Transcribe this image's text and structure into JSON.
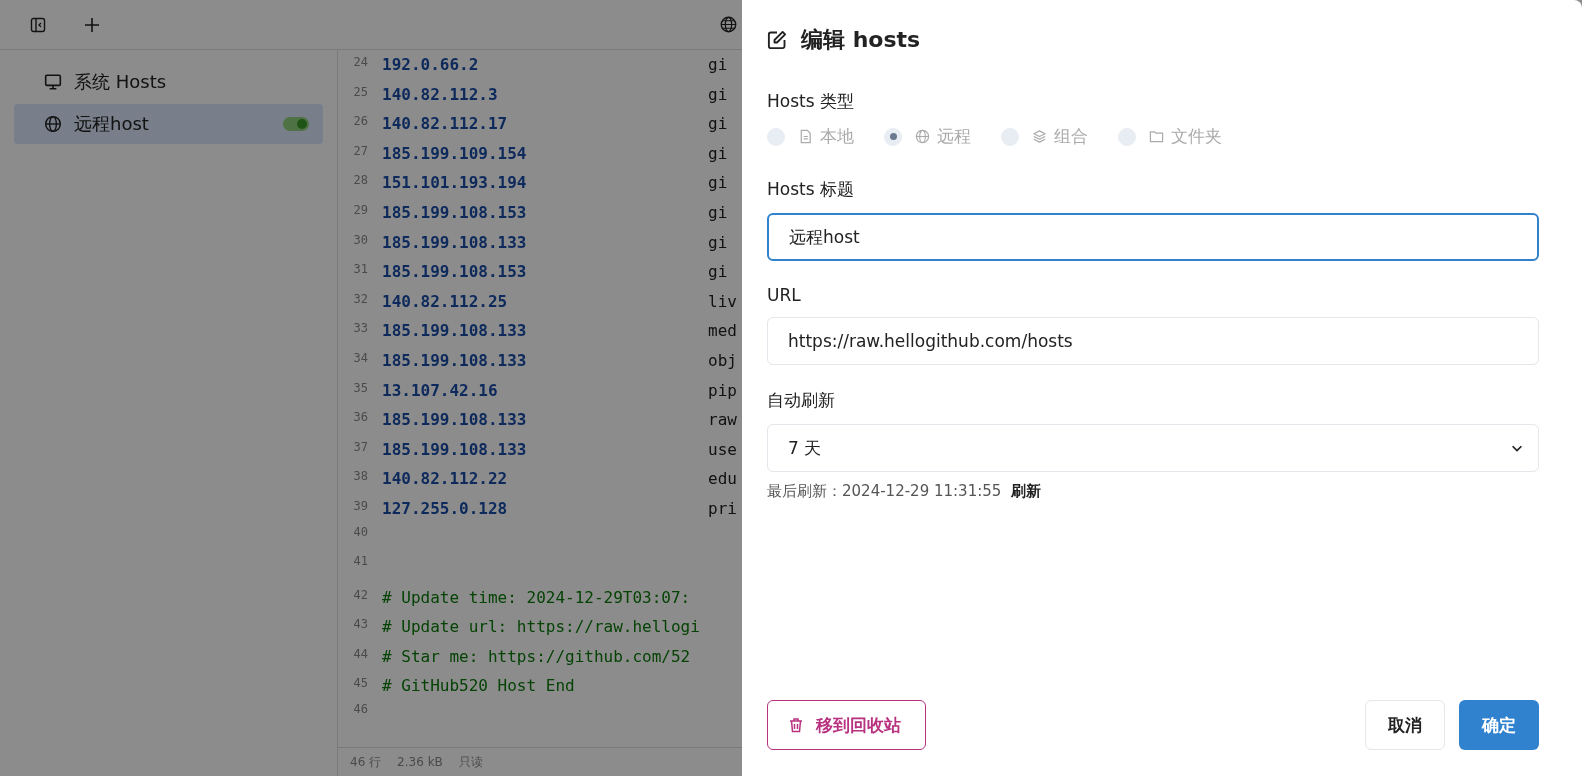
{
  "sidebar": {
    "items": [
      {
        "label": "系统 Hosts",
        "kind": "system",
        "selected": false
      },
      {
        "label": "远程host",
        "kind": "remote",
        "selected": true,
        "on": true
      }
    ]
  },
  "editor": {
    "lines": [
      {
        "number": "24",
        "ip": "192.0.66.2",
        "host": "gi"
      },
      {
        "number": "25",
        "ip": "140.82.112.3",
        "host": "gi"
      },
      {
        "number": "26",
        "ip": "140.82.112.17",
        "host": "gi"
      },
      {
        "number": "27",
        "ip": "185.199.109.154",
        "host": "gi"
      },
      {
        "number": "28",
        "ip": "151.101.193.194",
        "host": "gi"
      },
      {
        "number": "29",
        "ip": "185.199.108.153",
        "host": "gi"
      },
      {
        "number": "30",
        "ip": "185.199.108.133",
        "host": "gi"
      },
      {
        "number": "31",
        "ip": "185.199.108.153",
        "host": "gi"
      },
      {
        "number": "32",
        "ip": "140.82.112.25",
        "host": "liv"
      },
      {
        "number": "33",
        "ip": "185.199.108.133",
        "host": "med"
      },
      {
        "number": "34",
        "ip": "185.199.108.133",
        "host": "obj"
      },
      {
        "number": "35",
        "ip": "13.107.42.16",
        "host": "pip"
      },
      {
        "number": "36",
        "ip": "185.199.108.133",
        "host": "raw"
      },
      {
        "number": "37",
        "ip": "185.199.108.133",
        "host": "use"
      },
      {
        "number": "38",
        "ip": "140.82.112.22",
        "host": "edu"
      },
      {
        "number": "39",
        "ip": "127.255.0.128",
        "host": "pri"
      },
      {
        "number": "40"
      },
      {
        "number": "41"
      },
      {
        "number": "42",
        "comment": "# Update time: 2024-12-29T03:07:"
      },
      {
        "number": "43",
        "comment": "# Update url: https://raw.hellogi"
      },
      {
        "number": "44",
        "comment": "# Star me: https://github.com/52"
      },
      {
        "number": "45",
        "comment": "# GitHub520 Host End"
      },
      {
        "number": "46"
      }
    ]
  },
  "status_bar": {
    "lines": "46 行",
    "size": "2.36 kB",
    "mode": "只读"
  },
  "dialog": {
    "title": "编辑 hosts",
    "type_label": "Hosts 类型",
    "types": [
      {
        "label": "本地",
        "kind": "local",
        "selected": false
      },
      {
        "label": "远程",
        "kind": "remote",
        "selected": true
      },
      {
        "label": "组合",
        "kind": "group",
        "selected": false
      },
      {
        "label": "文件夹",
        "kind": "folder",
        "selected": false
      }
    ],
    "types_disabled": true,
    "title_label": "Hosts 标题",
    "title_value": "远程host",
    "url_label": "URL",
    "url_value": "https://raw.hellogithub.com/hosts",
    "refresh_label": "自动刷新",
    "refresh_value": "7 天",
    "last_refresh": "最后刷新：2024-12-29 11:31:55",
    "refresh_link": "刷新",
    "delete_button": "移到回收站",
    "cancel_button": "取消",
    "ok_button": "确定"
  }
}
